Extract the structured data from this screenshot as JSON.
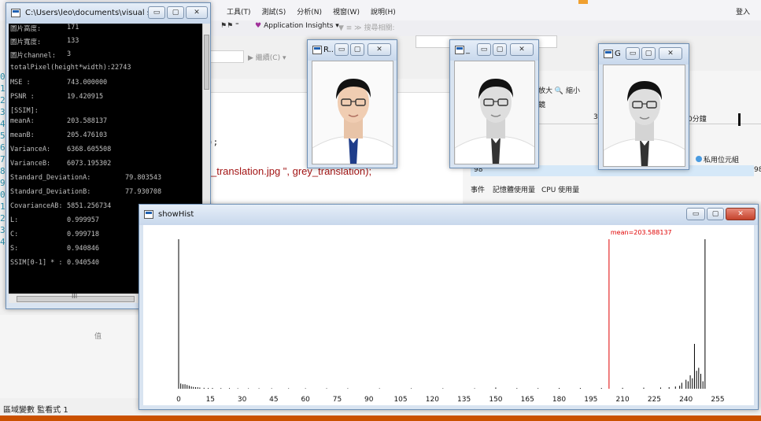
{
  "ide": {
    "menu": [
      "工具(T)",
      "測試(S)",
      "分析(N)",
      "視窗(W)",
      "說明(H)"
    ],
    "login": "登入",
    "app_insights": "Application Insights",
    "solution_platform_hint": "搜尋相關",
    "continue_label": "繼續(C)",
    "code_line_1": ");",
    "code_line_2_string": "_translation.jpg \", grey_translation);",
    "zoom_in": "放大",
    "zoom_out": "縮小",
    "lens": "鏡",
    "timeline_tick_1": "3",
    "timeline_tick_2": "0分鐘",
    "private_bytes": "私用位元組",
    "mem_left": "98",
    "mem_right": "98",
    "tabs": [
      "事件",
      "記憶體使用量",
      "CPU 使用量"
    ],
    "lower_left_value": "值",
    "status_text": "區域變數  監看式 1"
  },
  "console": {
    "title": "C:\\Users\\leo\\documents\\visual st...",
    "lines": [
      {
        "label": "圖片高度:",
        "value": "171"
      },
      {
        "label": "圖片寬度:",
        "value": "133"
      },
      {
        "label": "圖片channel:",
        "value": "3"
      },
      {
        "label": "totalPixel(height*width):22743",
        "value": ""
      },
      {
        "label": "MSE :",
        "value": "743.000000"
      },
      {
        "label": "PSNR :",
        "value": "19.420915"
      },
      {
        "label": "[SSIM]:",
        "value": ""
      },
      {
        "label": "meanA:",
        "value": "203.588137"
      },
      {
        "label": "meanB:",
        "value": "205.476103"
      },
      {
        "label": "VarianceA:",
        "value": "6368.605508"
      },
      {
        "label": "VarianceB:",
        "value": "6073.195302"
      },
      {
        "label": "Standard_DeviationA:",
        "value": "79.803543"
      },
      {
        "label": "Standard_DeviationB:",
        "value": "77.930708"
      },
      {
        "label": "CovarianceAB:",
        "value": "5851.256734"
      },
      {
        "label": "L:",
        "value": "0.999957"
      },
      {
        "label": "C:",
        "value": "0.999718"
      },
      {
        "label": "S:",
        "value": "0.940846"
      },
      {
        "label": "SSIM[0-1] * :",
        "value": "0.940540"
      }
    ]
  },
  "windows": {
    "img1_title": "R...",
    "img2_title": "_",
    "img3_title": "G",
    "hist_title": "showHist"
  },
  "chart_data": {
    "type": "bar",
    "title": "",
    "mean_label": "mean=203.588137",
    "mean_value": 203.588137,
    "xlabel": "",
    "ylabel": "",
    "xlim": [
      0,
      255
    ],
    "xticks": [
      0,
      15,
      30,
      45,
      60,
      75,
      90,
      105,
      120,
      135,
      150,
      165,
      180,
      195,
      210,
      225,
      240,
      255
    ],
    "ylim": [
      0,
      1
    ],
    "bars": [
      {
        "x": 0,
        "y": 1.0
      },
      {
        "x": 1,
        "y": 0.035
      },
      {
        "x": 2,
        "y": 0.03
      },
      {
        "x": 3,
        "y": 0.03
      },
      {
        "x": 4,
        "y": 0.025
      },
      {
        "x": 5,
        "y": 0.02
      },
      {
        "x": 6,
        "y": 0.015
      },
      {
        "x": 7,
        "y": 0.012
      },
      {
        "x": 8,
        "y": 0.01
      },
      {
        "x": 9,
        "y": 0.01
      },
      {
        "x": 10,
        "y": 0.008
      },
      {
        "x": 12,
        "y": 0.006
      },
      {
        "x": 14,
        "y": 0.005
      },
      {
        "x": 16,
        "y": 0.005
      },
      {
        "x": 20,
        "y": 0.004
      },
      {
        "x": 24,
        "y": 0.004
      },
      {
        "x": 28,
        "y": 0.003
      },
      {
        "x": 33,
        "y": 0.003
      },
      {
        "x": 38,
        "y": 0.003
      },
      {
        "x": 44,
        "y": 0.003
      },
      {
        "x": 52,
        "y": 0.003
      },
      {
        "x": 60,
        "y": 0.003
      },
      {
        "x": 70,
        "y": 0.003
      },
      {
        "x": 80,
        "y": 0.003
      },
      {
        "x": 95,
        "y": 0.003
      },
      {
        "x": 110,
        "y": 0.003
      },
      {
        "x": 125,
        "y": 0.003
      },
      {
        "x": 140,
        "y": 0.003
      },
      {
        "x": 150,
        "y": 0.008
      },
      {
        "x": 160,
        "y": 0.004
      },
      {
        "x": 170,
        "y": 0.004
      },
      {
        "x": 180,
        "y": 0.005
      },
      {
        "x": 190,
        "y": 0.005
      },
      {
        "x": 200,
        "y": 0.005
      },
      {
        "x": 210,
        "y": 0.006
      },
      {
        "x": 220,
        "y": 0.007
      },
      {
        "x": 228,
        "y": 0.008
      },
      {
        "x": 232,
        "y": 0.01
      },
      {
        "x": 235,
        "y": 0.015
      },
      {
        "x": 237,
        "y": 0.02
      },
      {
        "x": 238,
        "y": 0.04
      },
      {
        "x": 240,
        "y": 0.06
      },
      {
        "x": 241,
        "y": 0.05
      },
      {
        "x": 242,
        "y": 0.09
      },
      {
        "x": 243,
        "y": 0.07
      },
      {
        "x": 244,
        "y": 0.3
      },
      {
        "x": 245,
        "y": 0.12
      },
      {
        "x": 246,
        "y": 0.14
      },
      {
        "x": 247,
        "y": 0.1
      },
      {
        "x": 248,
        "y": 0.05
      },
      {
        "x": 249,
        "y": 1.0
      }
    ],
    "colors": {
      "bar": "#000000",
      "mean_line": "#e00000"
    }
  }
}
